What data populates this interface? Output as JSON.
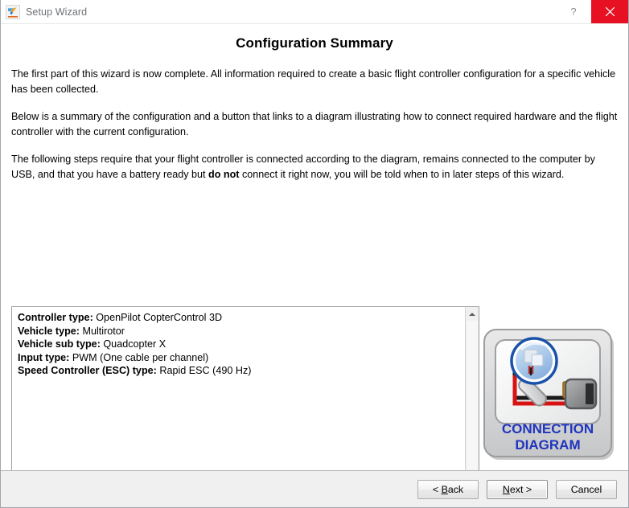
{
  "window": {
    "title": "Setup Wizard",
    "app_icon": "openpilot-logo-icon",
    "help_label": "?",
    "close_label": "✕"
  },
  "page": {
    "title": "Configuration Summary",
    "paragraph_1": "The first part of this wizard is now complete. All information required to create a basic flight controller configuration for a specific vehicle has been collected.",
    "paragraph_2": "Below is a summary of the configuration and a button that links to a diagram illustrating how to connect required hardware and the flight controller with the current configuration.",
    "paragraph_3_before": "The following steps require that your flight controller is connected according to the diagram, remains connected to the computer by USB, and that you have a battery ready but ",
    "paragraph_3_bold": "do not",
    "paragraph_3_after": " connect it right now, you will be told when to in later steps of this wizard."
  },
  "summary": {
    "items": [
      {
        "label": "Controller type:",
        "value": "OpenPilot CopterControl 3D"
      },
      {
        "label": "Vehicle type:",
        "value": "Multirotor"
      },
      {
        "label": "Vehicle sub type:",
        "value": "Quadcopter X"
      },
      {
        "label": "Input type:",
        "value": "PWM (One cable per channel)"
      },
      {
        "label": "Speed Controller (ESC) type:",
        "value": "Rapid ESC (490 Hz)"
      }
    ],
    "scrollbar": {
      "up_arrow": "scroll-up-arrow-icon",
      "down_arrow": "scroll-down-arrow-icon"
    }
  },
  "diagram_button": {
    "line1": "CONNECTION",
    "line2": "DIAGRAM",
    "text_color": "#1f35bd",
    "icon": "magnifier-over-connector-icon"
  },
  "footer": {
    "back": {
      "pre": "< ",
      "mnemonic": "B",
      "post": "ack"
    },
    "next": {
      "pre": "",
      "mnemonic": "N",
      "post": "ext >"
    },
    "cancel": {
      "label": "Cancel"
    }
  },
  "colors": {
    "close_button": "#e81123",
    "footer_bg": "#f0f0f0",
    "title_text": "#6e7276",
    "diagram_blue": "#1f35bd"
  }
}
